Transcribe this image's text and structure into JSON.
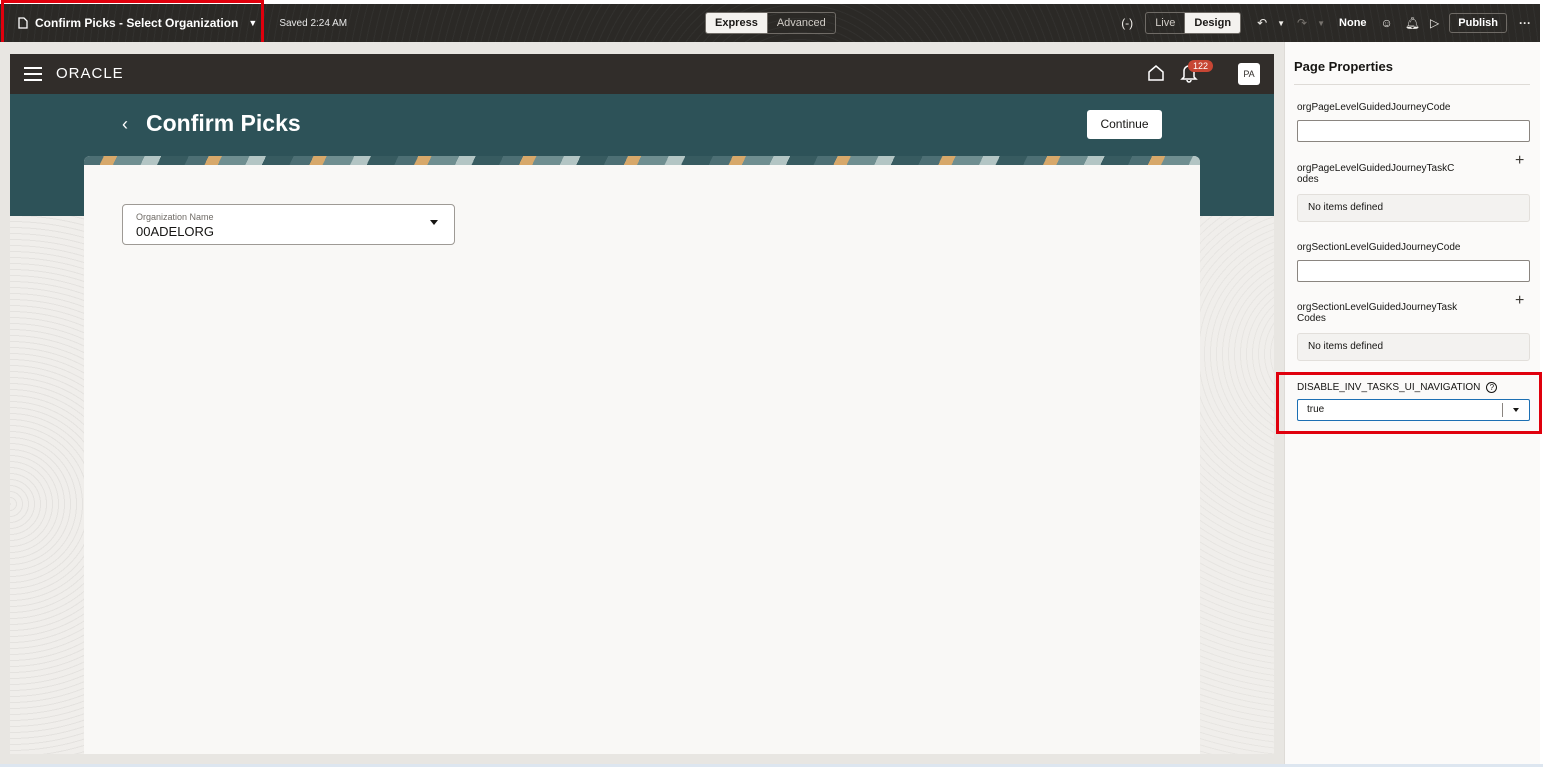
{
  "toolbar": {
    "page_title": "Confirm Picks - Select Organization",
    "saved_text": "Saved 2:24 AM",
    "mode_express": "Express",
    "mode_advanced": "Advanced",
    "view_live": "Live",
    "view_design": "Design",
    "none_label": "None",
    "publish_label": "Publish"
  },
  "app": {
    "logo": "ORACLE",
    "notification_count": "122",
    "avatar_initials": "PA",
    "page_heading": "Confirm Picks",
    "continue_label": "Continue",
    "org_field_label": "Organization Name",
    "org_field_value": "00ADELORG"
  },
  "panel": {
    "title": "Page Properties",
    "prop1_label": "orgPageLevelGuidedJourneyCode",
    "prop2_label_line1": "orgPageLevelGuidedJourneyTaskC",
    "prop2_label_line2": "odes",
    "prop2_empty": "No items defined",
    "prop3_label": "orgSectionLevelGuidedJourneyCode",
    "prop4_label_line1": "orgSectionLevelGuidedJourneyTask",
    "prop4_label_line2": "Codes",
    "prop4_empty": "No items defined",
    "prop5_label": "DISABLE_INV_TASKS_UI_NAVIGATION",
    "prop5_value": "true"
  },
  "colors": {
    "header_teal": "#2d5258",
    "oracle_bar": "#312d2a",
    "highlight_red": "#e0000d",
    "focus_blue": "#1c6fb3"
  }
}
